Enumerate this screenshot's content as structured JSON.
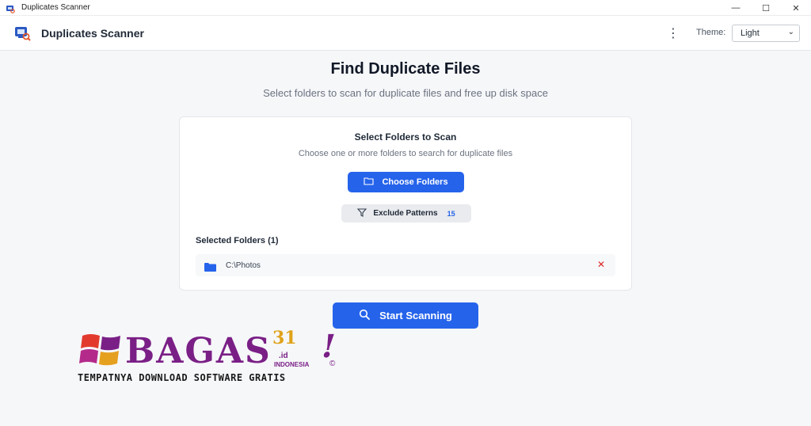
{
  "window": {
    "title": "Duplicates Scanner",
    "controls": {
      "minimize": "—",
      "maximize": "☐",
      "close": "✕"
    }
  },
  "header": {
    "app_name": "Duplicates Scanner",
    "menu_icon": "kebab-menu-icon",
    "theme_label": "Theme:",
    "theme_value": "Light"
  },
  "main": {
    "title": "Find Duplicate Files",
    "subtitle": "Select folders to scan for duplicate files and free up disk space"
  },
  "card": {
    "title": "Select Folders to Scan",
    "description": "Choose one or more folders to search for duplicate files",
    "choose_button": "Choose Folders",
    "exclude_button": "Exclude Patterns",
    "exclude_count": "15",
    "selected_label": "Selected Folders (1)",
    "folders": [
      {
        "path": "C:\\Photos"
      }
    ]
  },
  "start_button": "Start Scanning",
  "watermark": {
    "brand": "BAGAS",
    "number": "31",
    "tld": ".id",
    "country": "INDONESIA",
    "exclamation": "!",
    "copyright": "©",
    "tagline": "TEMPATNYA DOWNLOAD SOFTWARE GRATIS"
  },
  "colors": {
    "accent": "#2563eb",
    "danger": "#dc2626",
    "watermark_purple": "#7a1f86",
    "watermark_gold": "#e0a21a"
  }
}
